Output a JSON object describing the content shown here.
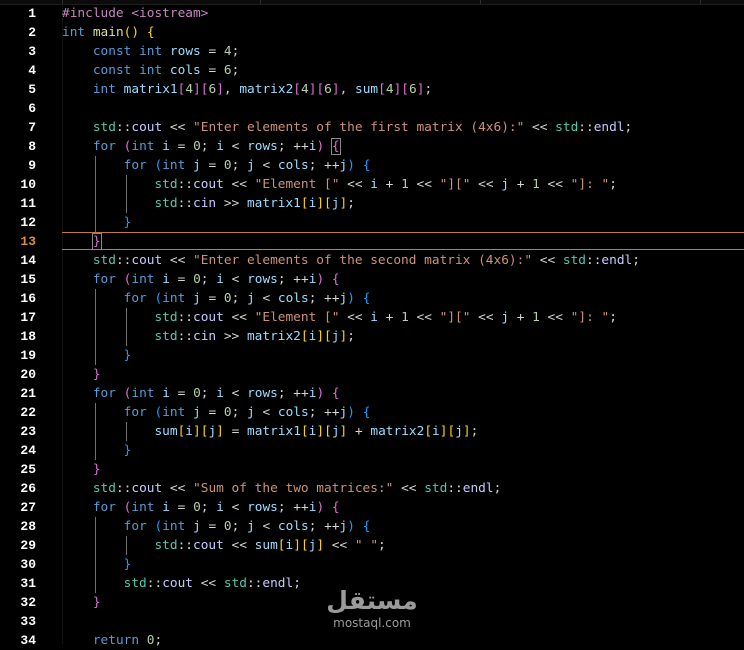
{
  "editor": {
    "current_line": 13,
    "colors": {
      "background": "#000000",
      "line_number": "#ffffff",
      "current_line_number": "#d78b3f",
      "current_line_border": "#c07a3a"
    },
    "lines": [
      {
        "n": "1",
        "text": "#include <iostream>"
      },
      {
        "n": "2",
        "text": "int main() {"
      },
      {
        "n": "3",
        "text": "    const int rows = 4;"
      },
      {
        "n": "4",
        "text": "    const int cols = 6;"
      },
      {
        "n": "5",
        "text": "    int matrix1[4][6], matrix2[4][6], sum[4][6];"
      },
      {
        "n": "6",
        "text": ""
      },
      {
        "n": "7",
        "text": "    std::cout << \"Enter elements of the first matrix (4x6):\" << std::endl;"
      },
      {
        "n": "8",
        "text": "    for (int i = 0; i < rows; ++i) {"
      },
      {
        "n": "9",
        "text": "        for (int j = 0; j < cols; ++j) {"
      },
      {
        "n": "10",
        "text": "            std::cout << \"Element [\" << i + 1 << \"][\" << j + 1 << \"]: \";"
      },
      {
        "n": "11",
        "text": "            std::cin >> matrix1[i][j];"
      },
      {
        "n": "12",
        "text": "        }"
      },
      {
        "n": "13",
        "text": "    }"
      },
      {
        "n": "14",
        "text": "    std::cout << \"Enter elements of the second matrix (4x6):\" << std::endl;"
      },
      {
        "n": "15",
        "text": "    for (int i = 0; i < rows; ++i) {"
      },
      {
        "n": "16",
        "text": "        for (int j = 0; j < cols; ++j) {"
      },
      {
        "n": "17",
        "text": "            std::cout << \"Element [\" << i + 1 << \"][\" << j + 1 << \"]: \";"
      },
      {
        "n": "18",
        "text": "            std::cin >> matrix2[i][j];"
      },
      {
        "n": "19",
        "text": "        }"
      },
      {
        "n": "20",
        "text": "    }"
      },
      {
        "n": "21",
        "text": "    for (int i = 0; i < rows; ++i) {"
      },
      {
        "n": "22",
        "text": "        for (int j = 0; j < cols; ++j) {"
      },
      {
        "n": "23",
        "text": "            sum[i][j] = matrix1[i][j] + matrix2[i][j];"
      },
      {
        "n": "24",
        "text": "        }"
      },
      {
        "n": "25",
        "text": "    }"
      },
      {
        "n": "26",
        "text": "    std::cout << \"Sum of the two matrices:\" << std::endl;"
      },
      {
        "n": "27",
        "text": "    for (int i = 0; i < rows; ++i) {"
      },
      {
        "n": "28",
        "text": "        for (int j = 0; j < cols; ++j) {"
      },
      {
        "n": "29",
        "text": "            std::cout << sum[i][j] << \" \";"
      },
      {
        "n": "30",
        "text": "        }"
      },
      {
        "n": "31",
        "text": "        std::cout << std::endl;"
      },
      {
        "n": "32",
        "text": "    }"
      },
      {
        "n": "33",
        "text": ""
      },
      {
        "n": "34",
        "text": "    return 0;"
      }
    ]
  },
  "watermark": {
    "arabic": "مستقل",
    "latin": "mostaql.com"
  }
}
